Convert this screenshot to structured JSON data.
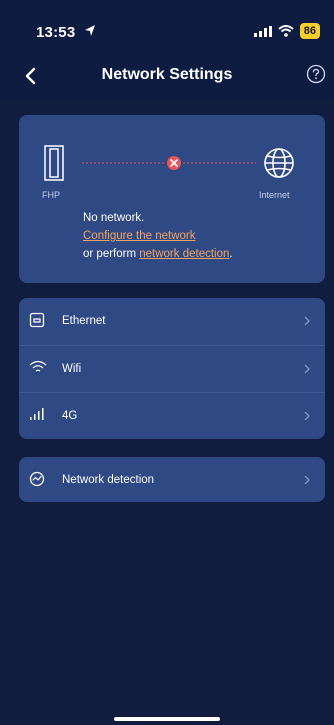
{
  "status_bar": {
    "time": "13:53",
    "battery": "86"
  },
  "nav": {
    "title": "Network Settings"
  },
  "diagram": {
    "device_label": "FHP",
    "internet_label": "Internet",
    "no_network": "No network.",
    "configure_link": "Configure the network",
    "or_perform": "or perform ",
    "detection_link": "network detection",
    "period": "."
  },
  "menu": {
    "items": [
      {
        "label": "Ethernet"
      },
      {
        "label": "Wifi"
      },
      {
        "label": "4G"
      }
    ]
  },
  "detect": {
    "label": "Network detection"
  },
  "colors": {
    "background": "#111d3e",
    "card": "#2f4984",
    "accent_link": "#f2a562",
    "error": "#e9555a"
  }
}
